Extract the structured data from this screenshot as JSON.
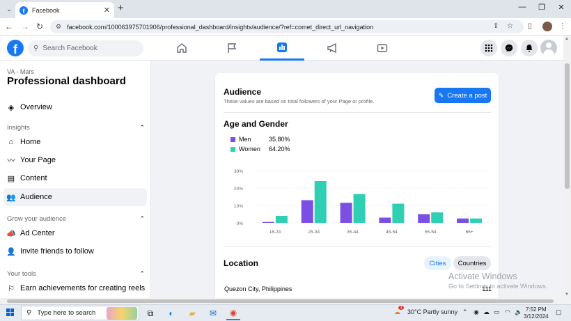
{
  "browser": {
    "tab_title": "Facebook",
    "tab_close": "✕",
    "new_tab": "+",
    "url": "facebook.com/100063975701906/professional_dashboard/insights/audience/?ref=comet_direct_url_navigation",
    "window_controls": [
      "—",
      "❐",
      "✕"
    ]
  },
  "fb": {
    "search_placeholder": "Search Facebook",
    "logo_letter": "f",
    "nav": [
      "home",
      "flag",
      "insights",
      "megaphone",
      "video"
    ],
    "active_nav": "insights"
  },
  "sidebar": {
    "subtitle": "VA - Mars",
    "title": "Professional dashboard",
    "overview": "Overview",
    "insights_header": "Insights",
    "insights_items": [
      {
        "label": "Home",
        "icon": "home-icon"
      },
      {
        "label": "Your Page",
        "icon": "trend-icon"
      },
      {
        "label": "Content",
        "icon": "content-icon"
      },
      {
        "label": "Audience",
        "icon": "people-icon",
        "active": true
      }
    ],
    "grow_header": "Grow your audience",
    "grow_items": [
      {
        "label": "Ad Center",
        "icon": "megaphone-icon"
      },
      {
        "label": "Invite friends to follow",
        "icon": "invite-icon"
      }
    ],
    "tools_header": "Your tools",
    "tools_items": [
      {
        "label": "Earn achievements for creating reels",
        "icon": "reels-icon"
      }
    ]
  },
  "audience": {
    "title": "Audience",
    "subtitle": "These values are based on total followers of your Page or profile.",
    "create_post": "Create a post",
    "age_gender_title": "Age and Gender",
    "legend": [
      {
        "name": "Men",
        "value": "35.80%",
        "color": "#7b4ee4"
      },
      {
        "name": "Women",
        "value": "64.20%",
        "color": "#2fcfb4"
      }
    ],
    "location_title": "Location",
    "location_tabs": [
      "Cities",
      "Countries"
    ],
    "location_active": "Cities",
    "location_rows": [
      {
        "name": "Quezon City, Philippines",
        "count": "111"
      }
    ]
  },
  "chart_data": {
    "type": "bar",
    "categories": [
      "18-24",
      "25-34",
      "35-44",
      "45-54",
      "55-64",
      "65+"
    ],
    "series": [
      {
        "name": "Men",
        "values": [
          0.5,
          13,
          11.5,
          3,
          5,
          2.5
        ],
        "color": "#7b4ee4"
      },
      {
        "name": "Women",
        "values": [
          4,
          24,
          16.5,
          11,
          6,
          2.5
        ],
        "color": "#2fcfb4"
      }
    ],
    "yticks": [
      "0%",
      "10%",
      "20%",
      "30%"
    ],
    "ylim": [
      0,
      30
    ],
    "grid": true
  },
  "watermark": {
    "line1": "Activate Windows",
    "line2": "Go to Settings to activate Windows."
  },
  "taskbar": {
    "search_placeholder": "Type here to search",
    "weather": "30°C  Partly sunny",
    "time": "7:52 PM",
    "date": "3/12/2024",
    "weather_badge": "1"
  }
}
